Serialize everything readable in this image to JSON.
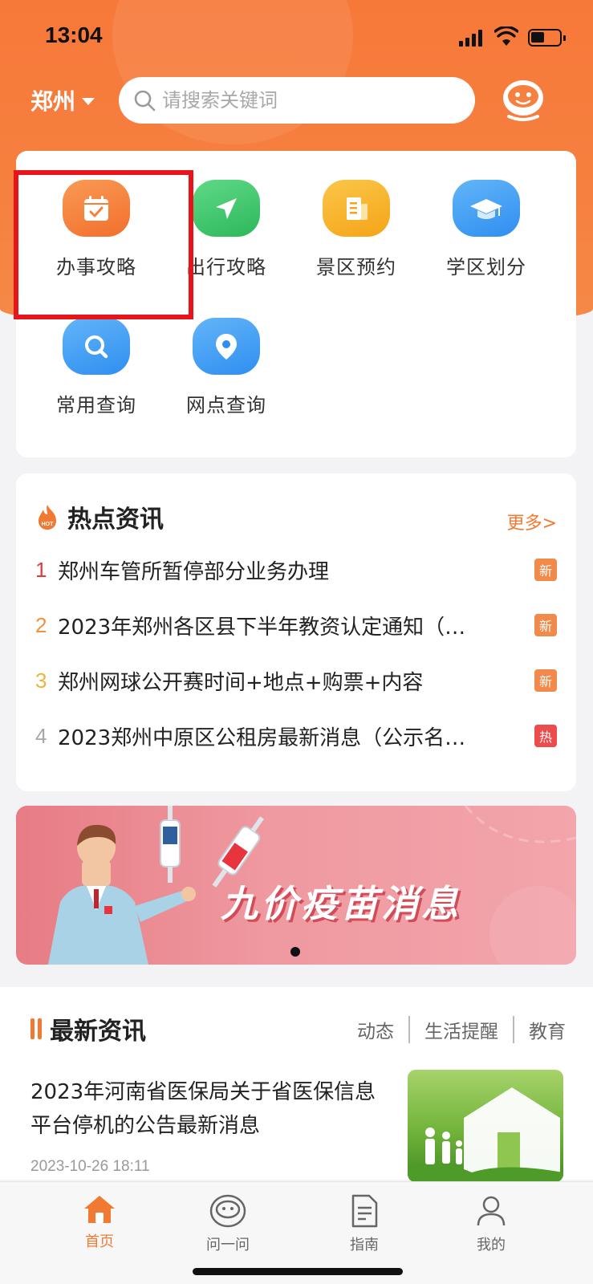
{
  "status": {
    "time": "13:04"
  },
  "header": {
    "city": "郑州",
    "search_placeholder": "请搜索关键词"
  },
  "services": [
    {
      "label": "办事攻略",
      "icon": "calendar-check-icon",
      "color": "#f6803a"
    },
    {
      "label": "出行攻略",
      "icon": "navigation-arrow-icon",
      "color": "#3ec76a"
    },
    {
      "label": "景区预约",
      "icon": "document-icon",
      "color": "#f9b21f"
    },
    {
      "label": "学区划分",
      "icon": "graduation-cap-icon",
      "color": "#3d9ef5"
    },
    {
      "label": "常用查询",
      "icon": "search-icon",
      "color": "#3d9ef5"
    },
    {
      "label": "网点查询",
      "icon": "location-pin-icon",
      "color": "#3d9ef5"
    }
  ],
  "hot_news": {
    "title": "热点资讯",
    "more": "更多>",
    "items": [
      {
        "num": "1",
        "text": "郑州车管所暂停部分业务办理",
        "tag": "新",
        "num_color": "#e23b3b",
        "tag_color": "#f28a4b"
      },
      {
        "num": "2",
        "text": "2023年郑州各区县下半年教资认定通知（…",
        "tag": "新",
        "num_color": "#f0923f",
        "tag_color": "#f28a4b"
      },
      {
        "num": "3",
        "text": "郑州网球公开赛时间+地点+购票+内容",
        "tag": "新",
        "num_color": "#f2b23a",
        "tag_color": "#f28a4b"
      },
      {
        "num": "4",
        "text": "2023郑州中原区公租房最新消息（公示名…",
        "tag": "热",
        "num_color": "#a8a8a8",
        "tag_color": "#ec4c4c"
      }
    ]
  },
  "banner": {
    "text": "九价疫苗消息"
  },
  "latest": {
    "title": "最新资讯",
    "tabs": [
      "动态",
      "生活提醒",
      "教育"
    ],
    "article": {
      "title": "2023年河南省医保局关于省医保信息平台停机的公告最新消息",
      "time": "2023-10-26 18:11"
    }
  },
  "tabbar": {
    "items": [
      {
        "label": "首页",
        "icon": "home-icon",
        "active": true
      },
      {
        "label": "问一问",
        "icon": "robot-icon",
        "active": false
      },
      {
        "label": "指南",
        "icon": "document-icon",
        "active": false
      },
      {
        "label": "我的",
        "icon": "user-icon",
        "active": false
      }
    ]
  }
}
